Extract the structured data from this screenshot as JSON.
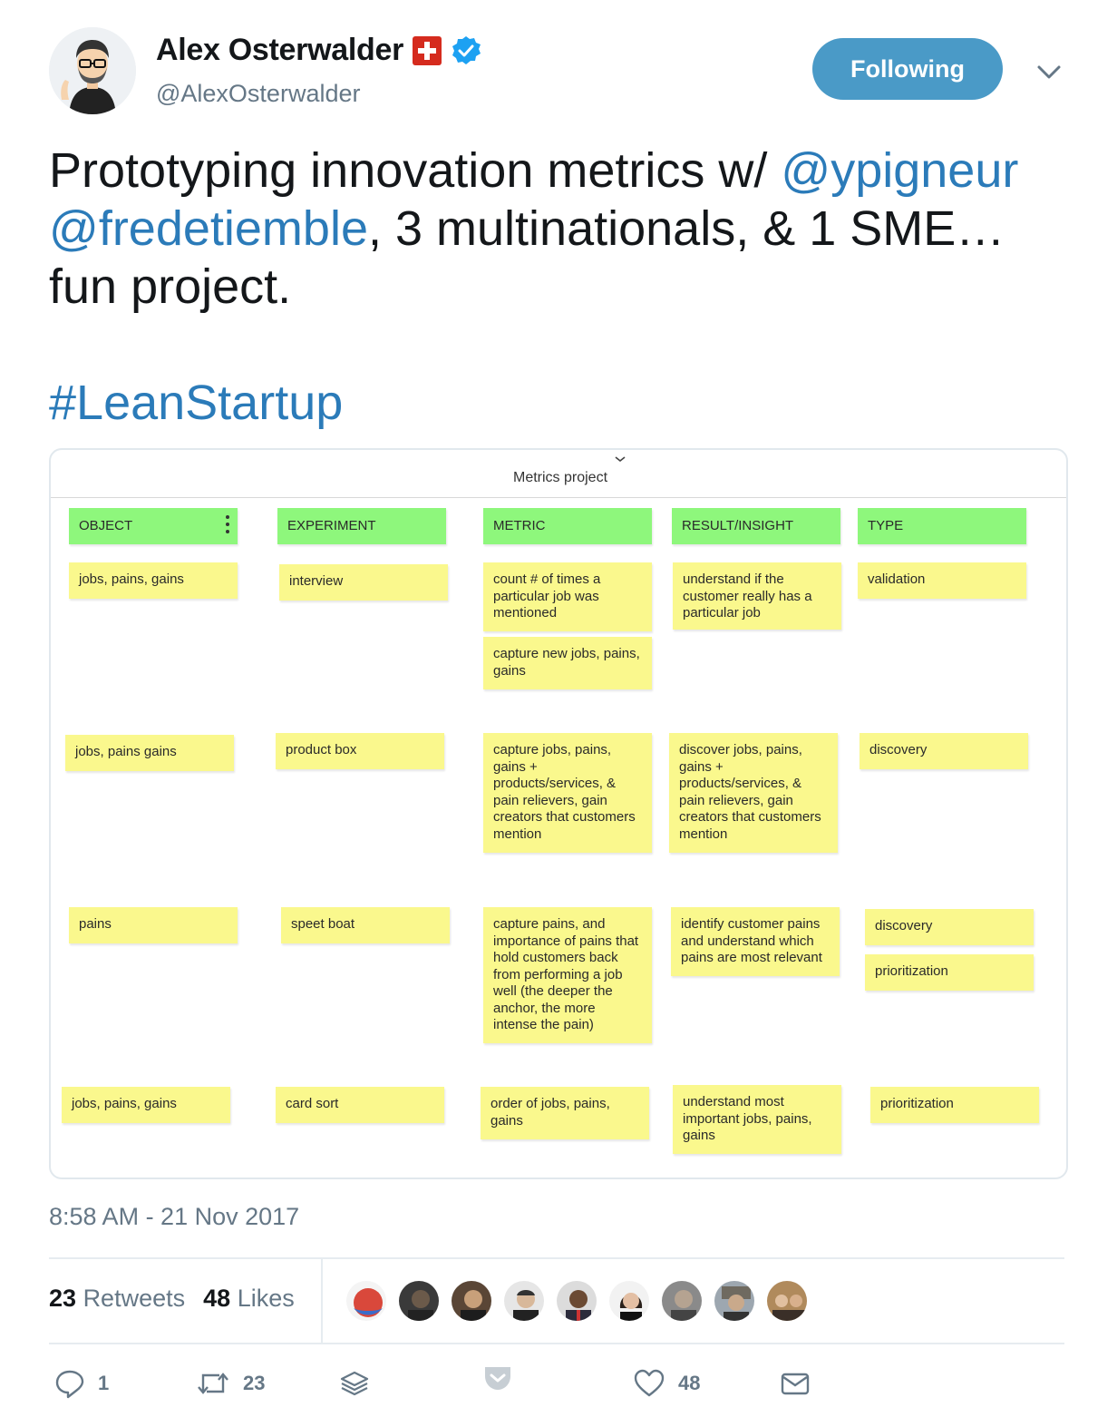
{
  "author": {
    "name": "Alex Osterwalder",
    "handle": "@AlexOsterwalder"
  },
  "follow_button_label": "Following",
  "tweet": {
    "part1": "Prototyping innovation metrics w/ ",
    "mention1": "@ypigneur",
    "mention2": "@fredetiemble",
    "part2": ", 3 multinationals, & 1 SME… fun project.",
    "hashtag": "#LeanStartup"
  },
  "board": {
    "title": "Metrics project",
    "headers": [
      "OBJECT",
      "EXPERIMENT",
      "METRIC",
      "RESULT/INSIGHT",
      "TYPE"
    ],
    "notes": {
      "r1_object": "jobs, pains, gains",
      "r1_experiment": "interview",
      "r1_metric_a": "count # of times a particular job was mentioned",
      "r1_metric_b": "capture new jobs, pains, gains",
      "r1_result": "understand if the customer really has a particular job",
      "r1_type": "validation",
      "r2_object": "jobs, pains gains",
      "r2_experiment": "product box",
      "r2_metric": "capture jobs, pains, gains + products/services, & pain relievers, gain creators that customers mention",
      "r2_result": "discover jobs, pains, gains + products/services, & pain relievers, gain creators that customers mention",
      "r2_type": "discovery",
      "r3_object": "pains",
      "r3_experiment": "speet boat",
      "r3_metric": "capture pains, and importance of pains that hold customers back from performing a job well (the deeper the anchor, the more intense the pain)",
      "r3_result": "identify customer pains and understand which pains are most relevant",
      "r3_type_a": "discovery",
      "r3_type_b": "prioritization",
      "r4_object": "jobs, pains, gains",
      "r4_experiment": "card sort",
      "r4_metric": "order of jobs, pains, gains",
      "r4_result": "understand most important jobs, pains, gains",
      "r4_type": "prioritization"
    },
    "colors": {
      "header_note": "#8ef77c",
      "sticky_note": "#faf88d"
    }
  },
  "timestamp": "8:58 AM - 21 Nov 2017",
  "stats": {
    "retweets_count": "23",
    "retweets_label": "Retweets",
    "likes_count": "48",
    "likes_label": "Likes"
  },
  "actions": {
    "reply_count": "1",
    "retweet_count": "23",
    "like_count": "48"
  },
  "accent": "#2b7bb9",
  "follow_button_color": "#4a9ac7"
}
